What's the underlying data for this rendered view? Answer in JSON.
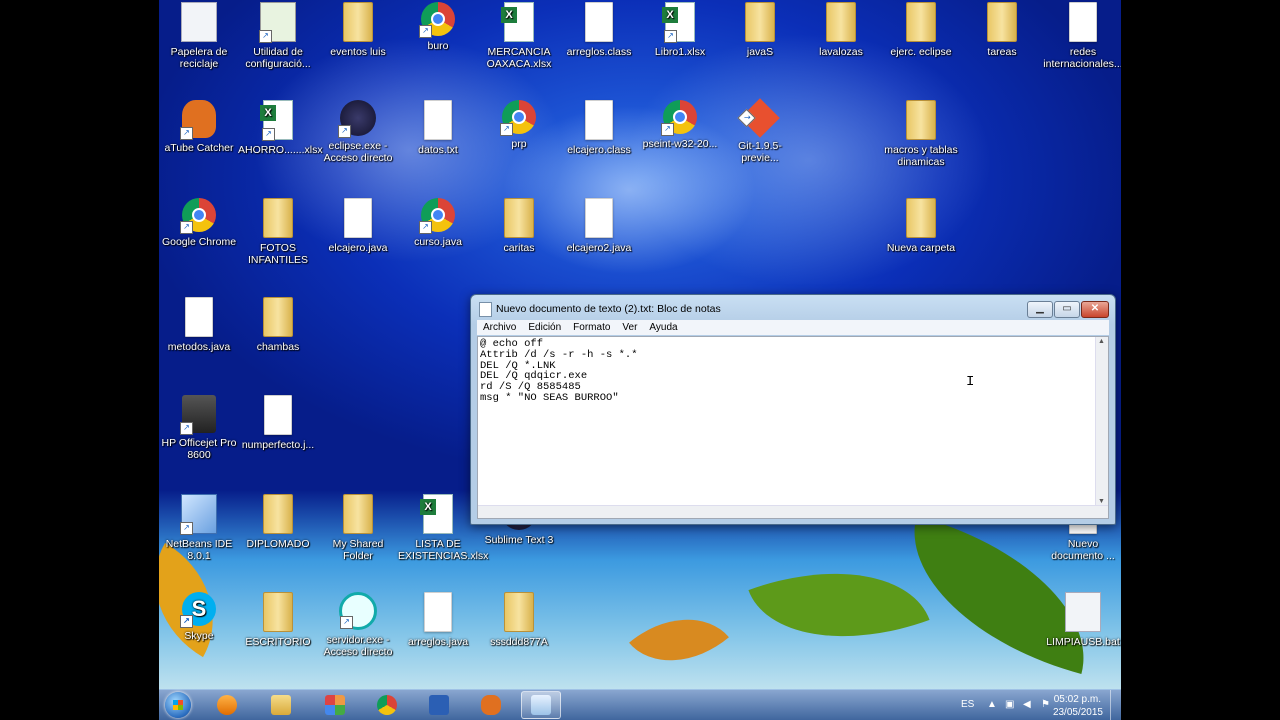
{
  "desktop_icons": [
    {
      "label": "Papelera de reciclaje",
      "icon": "recycle-bin-icon"
    },
    {
      "label": "Utilidad de configuració...",
      "icon": "wifi-config-icon"
    },
    {
      "label": "eventos luis",
      "icon": "folder-icon"
    },
    {
      "label": "buro",
      "icon": "chrome-icon"
    },
    {
      "label": "MERCANCIA OAXACA.xlsx",
      "icon": "excel-icon"
    },
    {
      "label": "arreglos.class",
      "icon": "file-icon"
    },
    {
      "label": "Libro1.xlsx",
      "icon": "excel-icon"
    },
    {
      "label": "javaS",
      "icon": "folder-icon"
    },
    {
      "label": "lavalozas",
      "icon": "folder-icon"
    },
    {
      "label": "ejerc. eclipse",
      "icon": "folder-icon"
    },
    {
      "label": "tareas",
      "icon": "folder-icon"
    },
    {
      "label": "redes internacionales...",
      "icon": "file-icon"
    },
    {
      "label": "aTube Catcher",
      "icon": "atube-icon"
    },
    {
      "label": "AHORRO.......xlsx",
      "icon": "excel-icon"
    },
    {
      "label": "eclipse.exe - Acceso directo",
      "icon": "eclipse-icon"
    },
    {
      "label": "datos.txt",
      "icon": "text-file-icon"
    },
    {
      "label": "prp",
      "icon": "chrome-icon"
    },
    {
      "label": "elcajero.class",
      "icon": "file-icon"
    },
    {
      "label": "pseint-w32-20...",
      "icon": "installer-icon"
    },
    {
      "label": "Git-1.9.5-previe...",
      "icon": "git-icon"
    },
    {
      "label": "macros y tablas dinamicas",
      "icon": "folder-icon"
    },
    {
      "label": "Google Chrome",
      "icon": "chrome-icon"
    },
    {
      "label": "FOTOS INFANTILES",
      "icon": "folder-icon"
    },
    {
      "label": "elcajero.java",
      "icon": "file-icon"
    },
    {
      "label": "curso.java",
      "icon": "chrome-icon"
    },
    {
      "label": "caritas",
      "icon": "folder-icon"
    },
    {
      "label": "elcajero2.java",
      "icon": "file-icon"
    },
    {
      "label": "Nueva carpeta",
      "icon": "folder-icon"
    },
    {
      "label": "metodos.java",
      "icon": "file-icon"
    },
    {
      "label": "chambas",
      "icon": "folder-icon"
    },
    {
      "label": "HP Officejet Pro 8600",
      "icon": "printer-icon"
    },
    {
      "label": "numperfecto.j...",
      "icon": "file-icon"
    },
    {
      "label": "NetBeans IDE 8.0.1",
      "icon": "netbeans-icon"
    },
    {
      "label": "DIPLOMADO",
      "icon": "folder-icon"
    },
    {
      "label": "My Shared Folder",
      "icon": "folder-icon"
    },
    {
      "label": "LISTA DE EXISTENCIAS.xlsx",
      "icon": "excel-icon"
    },
    {
      "label": "Sublime Text 3",
      "icon": "sublime-icon"
    },
    {
      "label": "Nuevo documento ...",
      "icon": "text-file-icon"
    },
    {
      "label": "Skype",
      "icon": "skype-icon"
    },
    {
      "label": "ESCRITORIO",
      "icon": "folder-icon"
    },
    {
      "label": "servidor.exe - Acceso directo",
      "icon": "clock-server-icon"
    },
    {
      "label": "arreglos.java",
      "icon": "file-icon"
    },
    {
      "label": "sssddd877A",
      "icon": "folder-icon"
    },
    {
      "label": "LIMPIAUSB.bat",
      "icon": "batch-gear-icon"
    }
  ],
  "notepad": {
    "title": "Nuevo documento de texto (2).txt: Bloc de notas",
    "minimize": "▁",
    "maximize": "▭",
    "close": "✕",
    "menu": [
      "Archivo",
      "Edición",
      "Formato",
      "Ver",
      "Ayuda"
    ],
    "content": "@ echo off\nAttrib /d /s -r -h -s *.*\nDEL /Q *.LNK\nDEL /Q qdqicr.exe\nrd /S /Q 8585485\nmsg * \"NO SEAS BURROO\""
  },
  "taskbar": {
    "apps": [
      "media-player-icon",
      "explorer-icon",
      "apps-grid-icon",
      "chrome-icon",
      "word-icon",
      "atube-icon",
      "notepad-icon"
    ],
    "language": "ES",
    "time": "05:02 p.m.",
    "date": "23/05/2015"
  }
}
